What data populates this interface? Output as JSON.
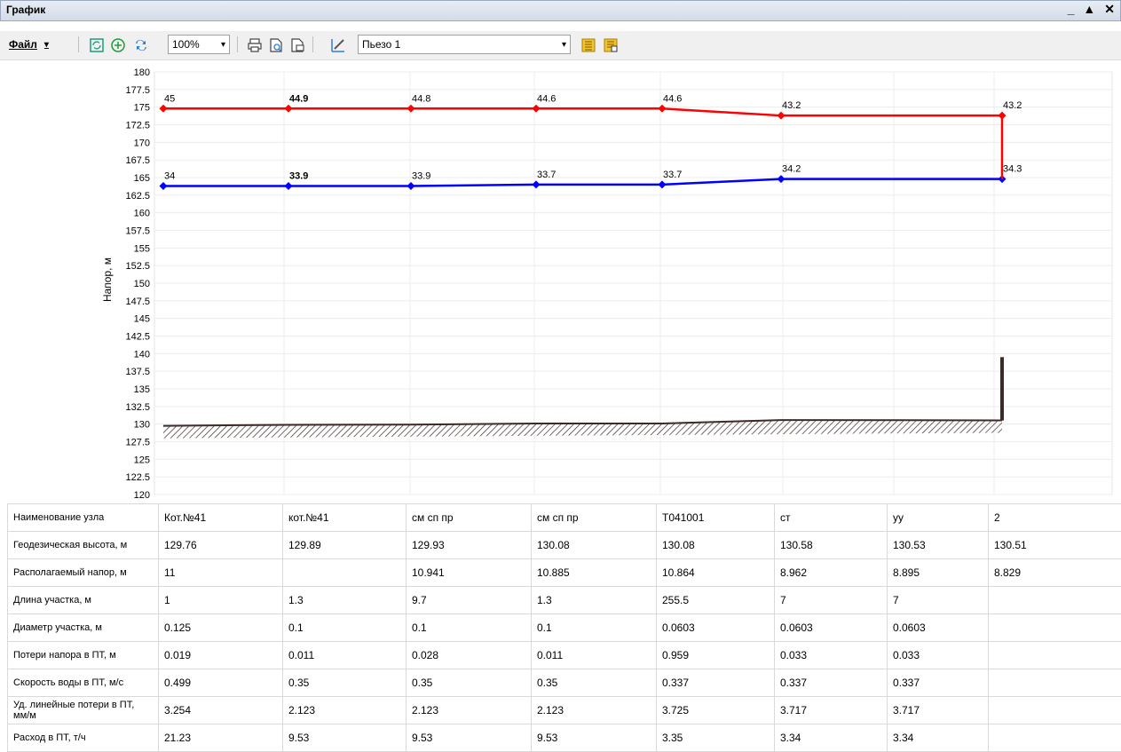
{
  "window": {
    "title": "График",
    "buttons": [
      "_",
      "▲",
      "✕"
    ]
  },
  "toolbar": {
    "file_label": "Файл",
    "zoom_value": "100%",
    "piezo_value": "Пьезо 1"
  },
  "chart_data": {
    "type": "line",
    "ylabel": "Напор, м",
    "ylim": [
      120,
      180
    ],
    "y_ticks": [
      120,
      122.5,
      125,
      127.5,
      130,
      132.5,
      135,
      137.5,
      140,
      142.5,
      145,
      147.5,
      150,
      152.5,
      155,
      157.5,
      160,
      162.5,
      165,
      167.5,
      170,
      172.5,
      175,
      177.5,
      180
    ],
    "x": [
      0,
      1,
      2,
      3,
      4,
      5,
      6.8
    ],
    "series": [
      {
        "color": "#ff0000",
        "values": [
          174.8,
          174.8,
          174.8,
          174.8,
          174.8,
          173.8,
          173.8
        ],
        "labels": [
          "45",
          "44.9",
          "44.8",
          "44.6",
          "44.6",
          "43.2",
          "43.2"
        ]
      },
      {
        "color": "#0000ff",
        "values": [
          163.8,
          163.8,
          163.8,
          164.0,
          164.0,
          164.8,
          164.8
        ],
        "labels": [
          "34",
          "33.9",
          "33.9",
          "33.7",
          "33.7",
          "34.2",
          "34.3"
        ]
      },
      {
        "color": "#3b2a28",
        "values": [
          129.76,
          129.89,
          129.93,
          130.08,
          130.08,
          130.58,
          130.53
        ]
      }
    ],
    "bar_at_end": {
      "x": 6.8,
      "from": 130.51,
      "to": 139.5
    }
  },
  "table": {
    "rows": [
      {
        "label": "Наименование узла",
        "values": [
          "Кот.№41",
          "кот.№41",
          "см сп пр",
          "см сп пр",
          "Т041001",
          "ст",
          "уу",
          "2"
        ]
      },
      {
        "label": "Геодезическая высота, м",
        "values": [
          "129.76",
          "129.89",
          "129.93",
          "130.08",
          "130.08",
          "130.58",
          "130.53",
          "130.51"
        ]
      },
      {
        "label": "Располагаемый напор, м",
        "values": [
          "11",
          "",
          "10.941",
          "10.885",
          "10.864",
          "8.962",
          "8.895",
          "8.829"
        ]
      },
      {
        "label": "Длина участка, м",
        "values": [
          "1",
          "1.3",
          "9.7",
          "1.3",
          "255.5",
          "7",
          "7",
          ""
        ]
      },
      {
        "label": "Диаметр участка, м",
        "values": [
          "0.125",
          "0.1",
          "0.1",
          "0.1",
          "0.0603",
          "0.0603",
          "0.0603",
          ""
        ]
      },
      {
        "label": "Потери напора в ПТ, м",
        "values": [
          "0.019",
          "0.011",
          "0.028",
          "0.011",
          "0.959",
          "0.033",
          "0.033",
          ""
        ]
      },
      {
        "label": "Скорость воды в ПТ, м/с",
        "values": [
          "0.499",
          "0.35",
          "0.35",
          "0.35",
          "0.337",
          "0.337",
          "0.337",
          ""
        ]
      },
      {
        "label": "Уд. линейные потери в ПТ, мм/м",
        "values": [
          "3.254",
          "2.123",
          "2.123",
          "2.123",
          "3.725",
          "3.717",
          "3.717",
          ""
        ]
      },
      {
        "label": "Расход в ПТ, т/ч",
        "values": [
          "21.23",
          "9.53",
          "9.53",
          "9.53",
          "3.35",
          "3.34",
          "3.34",
          ""
        ]
      }
    ]
  }
}
